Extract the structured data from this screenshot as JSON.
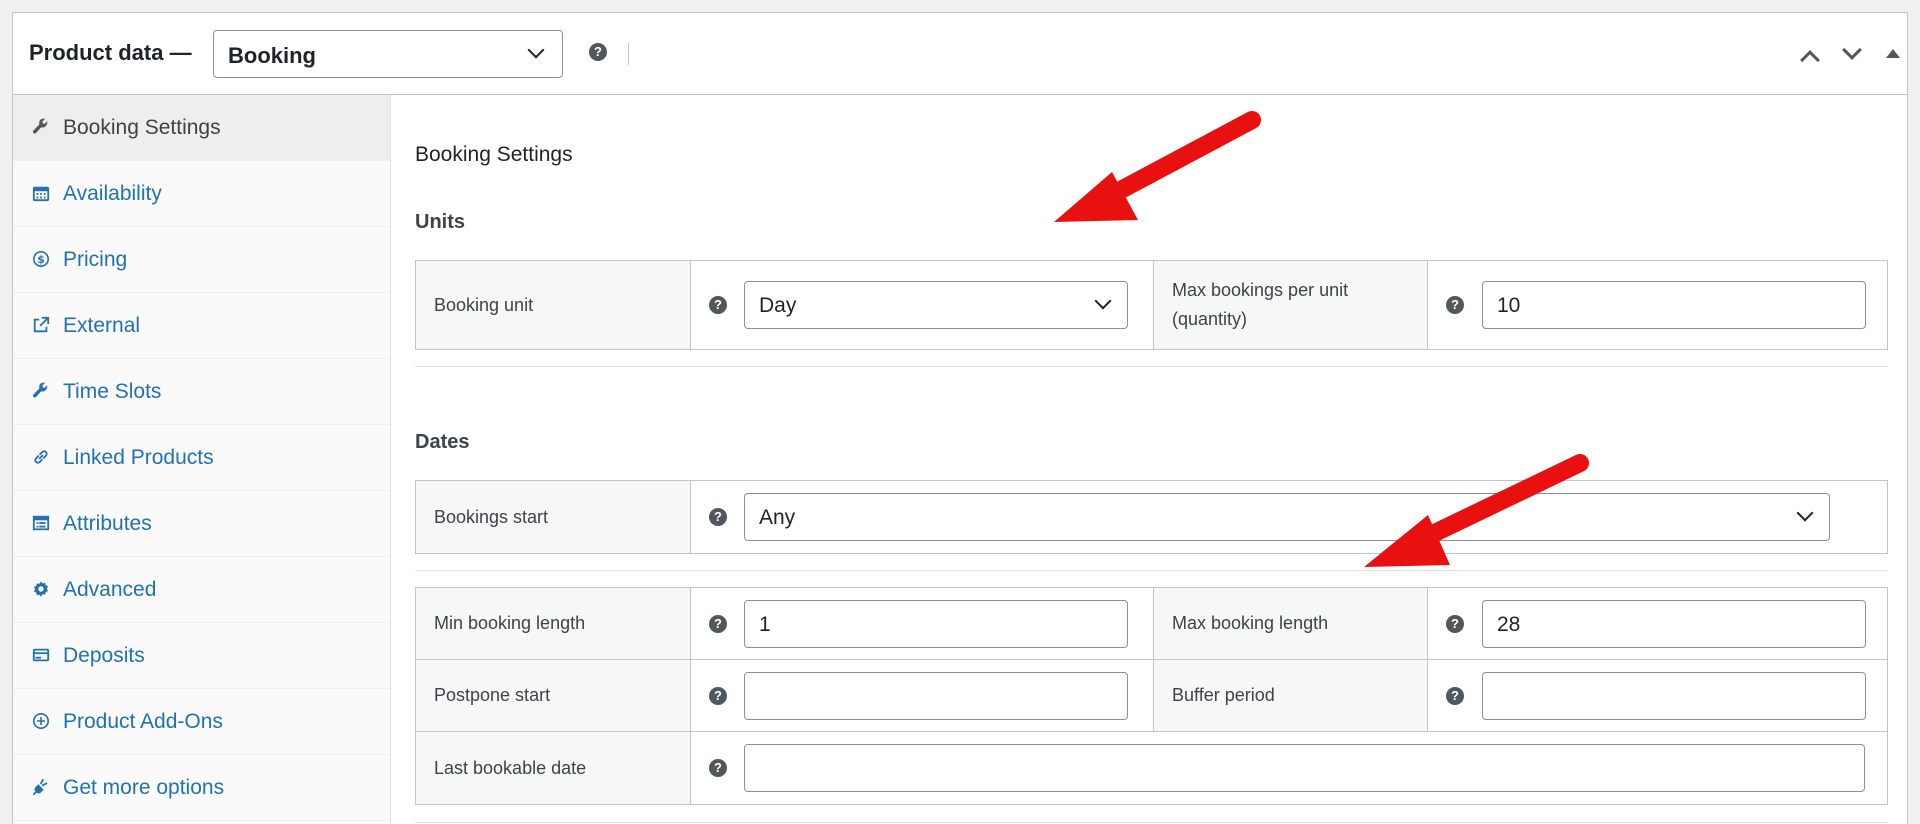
{
  "header": {
    "title": "Product data —",
    "product_type": "Booking",
    "help": "?"
  },
  "sidebar": {
    "items": [
      {
        "label": "Booking Settings",
        "icon": "wrench-icon",
        "active": true
      },
      {
        "label": "Availability",
        "icon": "calendar-icon"
      },
      {
        "label": "Pricing",
        "icon": "dollar-icon"
      },
      {
        "label": "External",
        "icon": "external-link-icon"
      },
      {
        "label": "Time Slots",
        "icon": "wrench-icon"
      },
      {
        "label": "Linked Products",
        "icon": "link-icon"
      },
      {
        "label": "Attributes",
        "icon": "list-icon"
      },
      {
        "label": "Advanced",
        "icon": "gear-icon"
      },
      {
        "label": "Deposits",
        "icon": "card-icon"
      },
      {
        "label": "Product Add-Ons",
        "icon": "plus-circle-icon"
      },
      {
        "label": "Get more options",
        "icon": "plugin-icon"
      }
    ]
  },
  "main": {
    "section_title": "Booking Settings",
    "units": {
      "title": "Units",
      "booking_unit_label": "Booking unit",
      "booking_unit_value": "Day",
      "max_bookings_label_line1": "Max bookings per unit",
      "max_bookings_label_line2": "(quantity)",
      "max_bookings_value": "10"
    },
    "dates": {
      "title": "Dates",
      "bookings_start_label": "Bookings start",
      "bookings_start_value": "Any",
      "min_length_label": "Min booking length",
      "min_length_value": "1",
      "max_length_label": "Max booking length",
      "max_length_value": "28",
      "postpone_label": "Postpone start",
      "postpone_value": "",
      "buffer_label": "Buffer period",
      "buffer_value": "",
      "last_date_label": "Last bookable date",
      "last_date_value": ""
    }
  },
  "colors": {
    "link": "#2271b1",
    "annotation_arrow": "#e8110f"
  }
}
